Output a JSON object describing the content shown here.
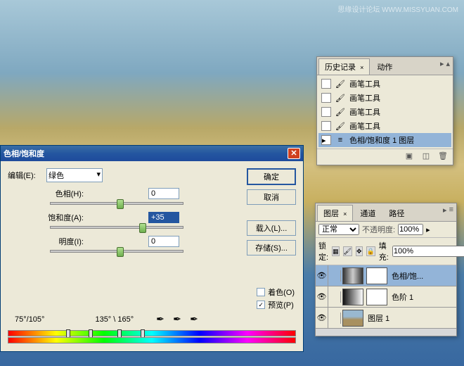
{
  "watermark": "思缘设计论坛 WWW.MISSYUAN.COM",
  "history": {
    "tabs": [
      "历史记录",
      "动作"
    ],
    "active_tab": 0,
    "close_x": "×",
    "items": [
      {
        "icon": "brush",
        "label": "画笔工具"
      },
      {
        "icon": "brush",
        "label": "画笔工具"
      },
      {
        "icon": "brush",
        "label": "画笔工具"
      },
      {
        "icon": "brush",
        "label": "画笔工具"
      },
      {
        "icon": "adjust",
        "label": "色相/饱和度 1 图层",
        "selected": true
      }
    ],
    "footer_icons": [
      "photo",
      "new",
      "trash"
    ]
  },
  "layers": {
    "tabs": [
      "图层",
      "通道",
      "路径"
    ],
    "active_tab": 0,
    "close_x": "×",
    "blend_mode": "正常",
    "opacity_label": "不透明度:",
    "opacity_value": "100%",
    "lock_label": "锁定:",
    "fill_label": "填充:",
    "fill_value": "100%",
    "items": [
      {
        "name": "色相/饱...",
        "selected": true,
        "thumbs": [
          "grad",
          "white"
        ]
      },
      {
        "name": "色阶 1",
        "thumbs": [
          "hist",
          "white"
        ]
      },
      {
        "name": "图层 1",
        "thumbs": [
          "land"
        ]
      }
    ]
  },
  "dialog": {
    "title": "色相/饱和度",
    "edit_label": "编辑(E):",
    "edit_value": "绿色",
    "sliders": {
      "hue": {
        "label": "色相(H):",
        "value": "0",
        "pos": 50
      },
      "sat": {
        "label": "饱和度(A):",
        "value": "+35",
        "pos": 68,
        "hl": true
      },
      "lig": {
        "label": "明度(I):",
        "value": "0",
        "pos": 50
      }
    },
    "buttons": {
      "ok": "确定",
      "cancel": "取消",
      "load": "载入(L)...",
      "save": "存储(S)..."
    },
    "colorize_label": "着色(O)",
    "preview_label": "预览(P)",
    "preview_checked": true,
    "range_left": "75°/105°",
    "range_right": "135° \\ 165°"
  }
}
